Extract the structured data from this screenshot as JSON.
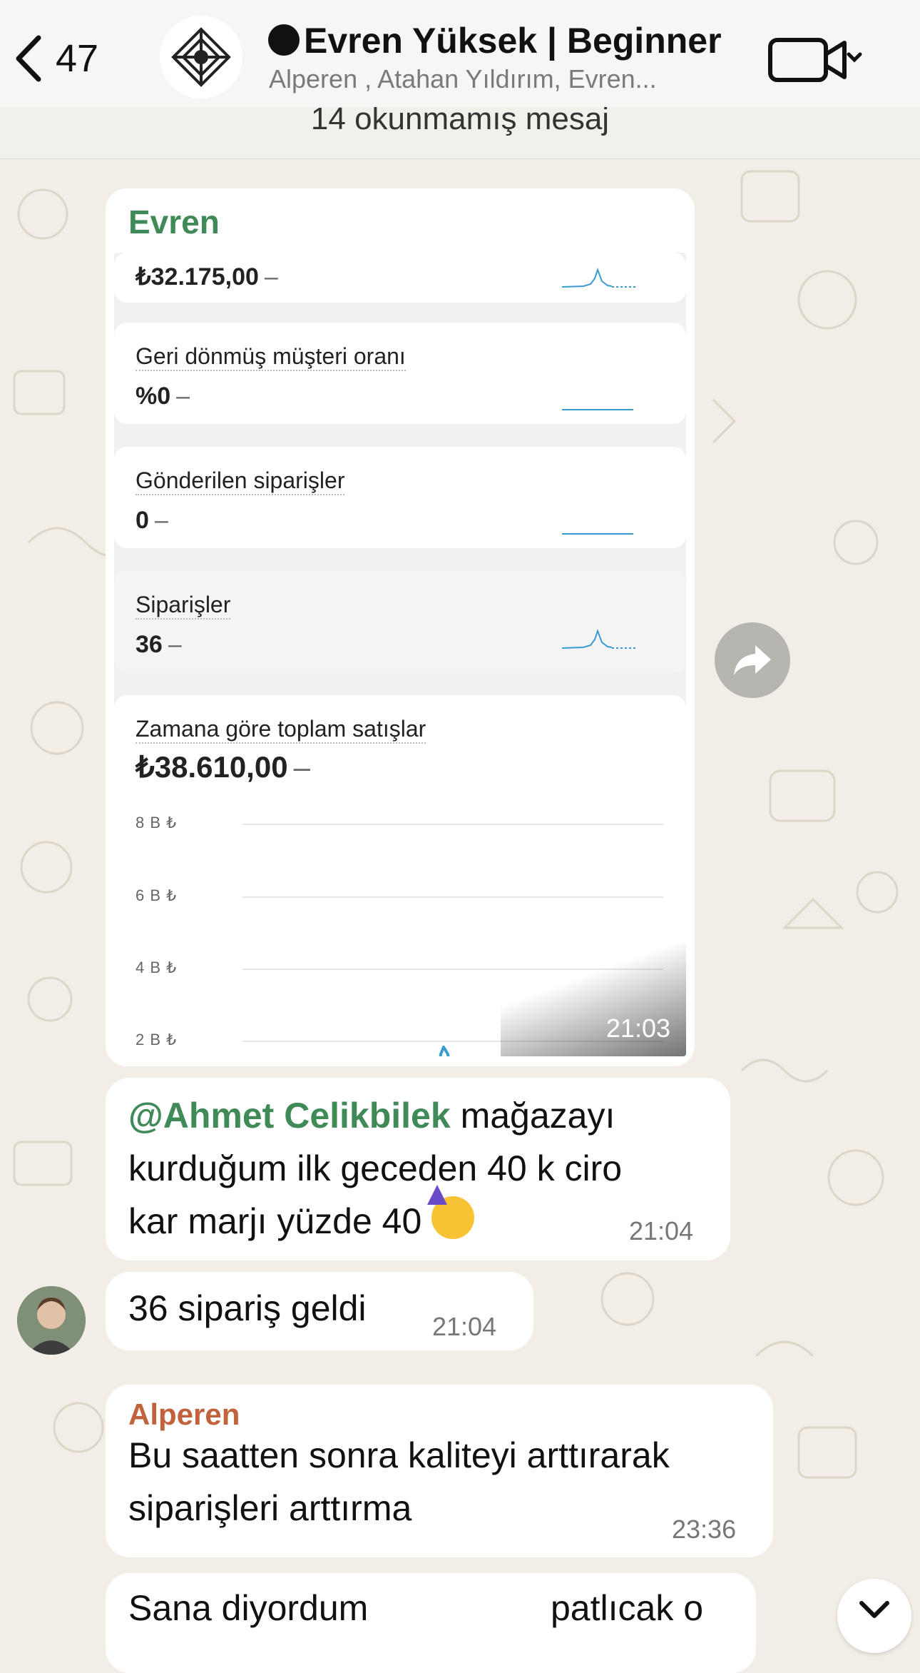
{
  "header": {
    "back_count": "47",
    "title": "Evren Yüksek | Beginner",
    "subtitle": "Alperen , Atahan Yıldırım, Evren..."
  },
  "unread_banner": "14 okunmamış mesaj",
  "image_message": {
    "sender": "Evren",
    "time": "21:03",
    "screenshot": {
      "rows": [
        {
          "title": "",
          "value": "₺32.175,00",
          "dash": "–"
        },
        {
          "title": "Geri dönmüş müşteri oranı",
          "value": "%0",
          "dash": "–"
        },
        {
          "title": "Gönderilen siparişler",
          "value": "0",
          "dash": "–"
        },
        {
          "title": "Siparişler",
          "value": "36",
          "dash": "–"
        }
      ],
      "sales_chart": {
        "title": "Zamana göre toplam satışlar",
        "value": "₺38.610,00",
        "dash": "–",
        "y_ticks": [
          "8 B ₺",
          "6 B ₺",
          "4 B ₺",
          "2 B ₺"
        ]
      }
    }
  },
  "messages": [
    {
      "mention": "@Ahmet Celikbilek",
      "text_line1": " mağazayı",
      "text_line2": "kurduğum ilk geceden 40 k ciro",
      "text_line3": "kar marjı yüzde 40",
      "emoji": "🥳",
      "time": "21:04"
    },
    {
      "text": "36 sipariş geldi",
      "time": "21:04"
    },
    {
      "sender": "Alperen",
      "text_line1": "Bu saatten sonra kaliteyi arttırarak",
      "text_line2": "siparişleri arttırma",
      "time": "23:36"
    },
    {
      "text_left": "Sana diyordum",
      "text_right": "patlıcak o"
    }
  ],
  "colors": {
    "mention_green": "#3f8a57",
    "sender_orange": "#c1623d",
    "chart_blue": "#3a9bd1"
  }
}
